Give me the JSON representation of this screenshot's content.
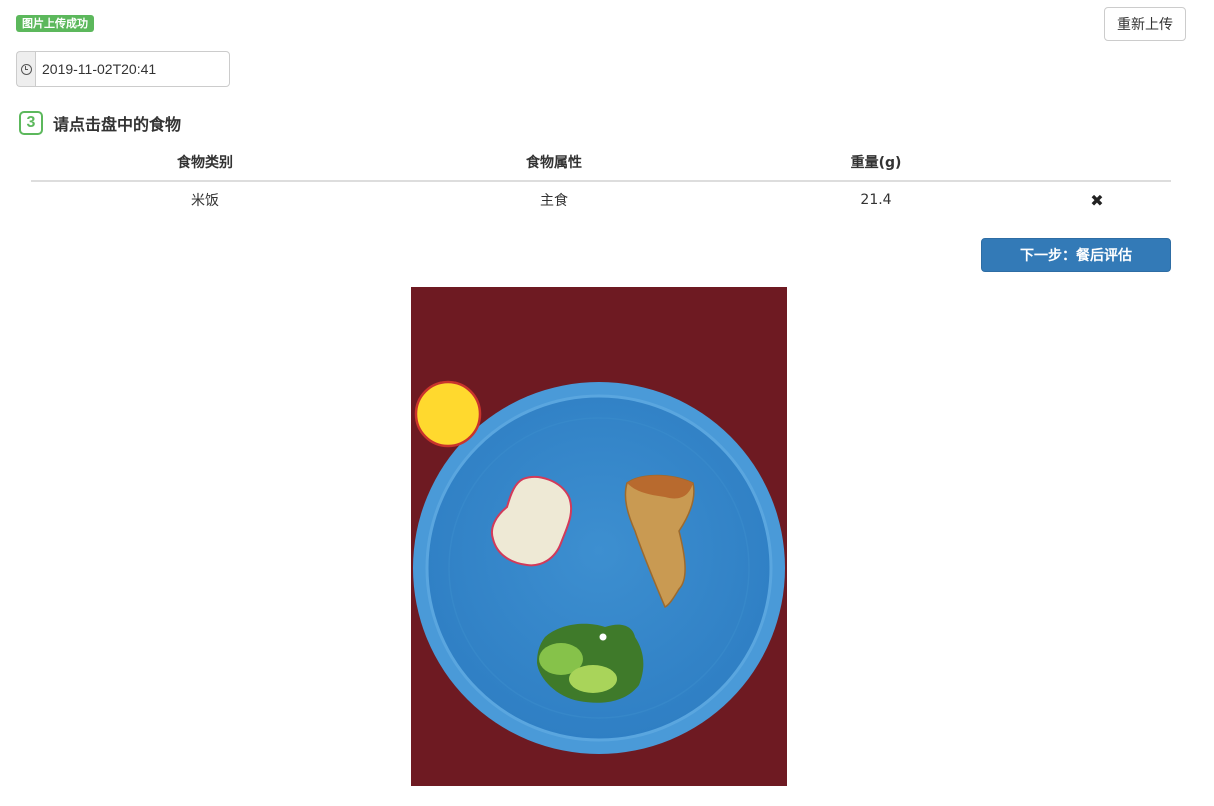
{
  "status_badge": "图片上传成功",
  "reupload_label": "重新上传",
  "datetime": {
    "icon": "clock-icon",
    "value": "2019-11-02T20:41"
  },
  "step": {
    "number": "3",
    "title": "请点击盘中的食物"
  },
  "table": {
    "headers": [
      "食物类别",
      "食物属性",
      "重量(g)",
      ""
    ],
    "rows": [
      {
        "category": "米饭",
        "attribute": "主食",
        "weight": "21.4",
        "delete_icon": "close-icon",
        "delete_glyph": "✖"
      }
    ]
  },
  "next_button_label": "下一步：餐后评估",
  "colors": {
    "success": "#5cb85c",
    "primary": "#337ab7"
  },
  "photo": {
    "icon": "food-plate-image"
  }
}
